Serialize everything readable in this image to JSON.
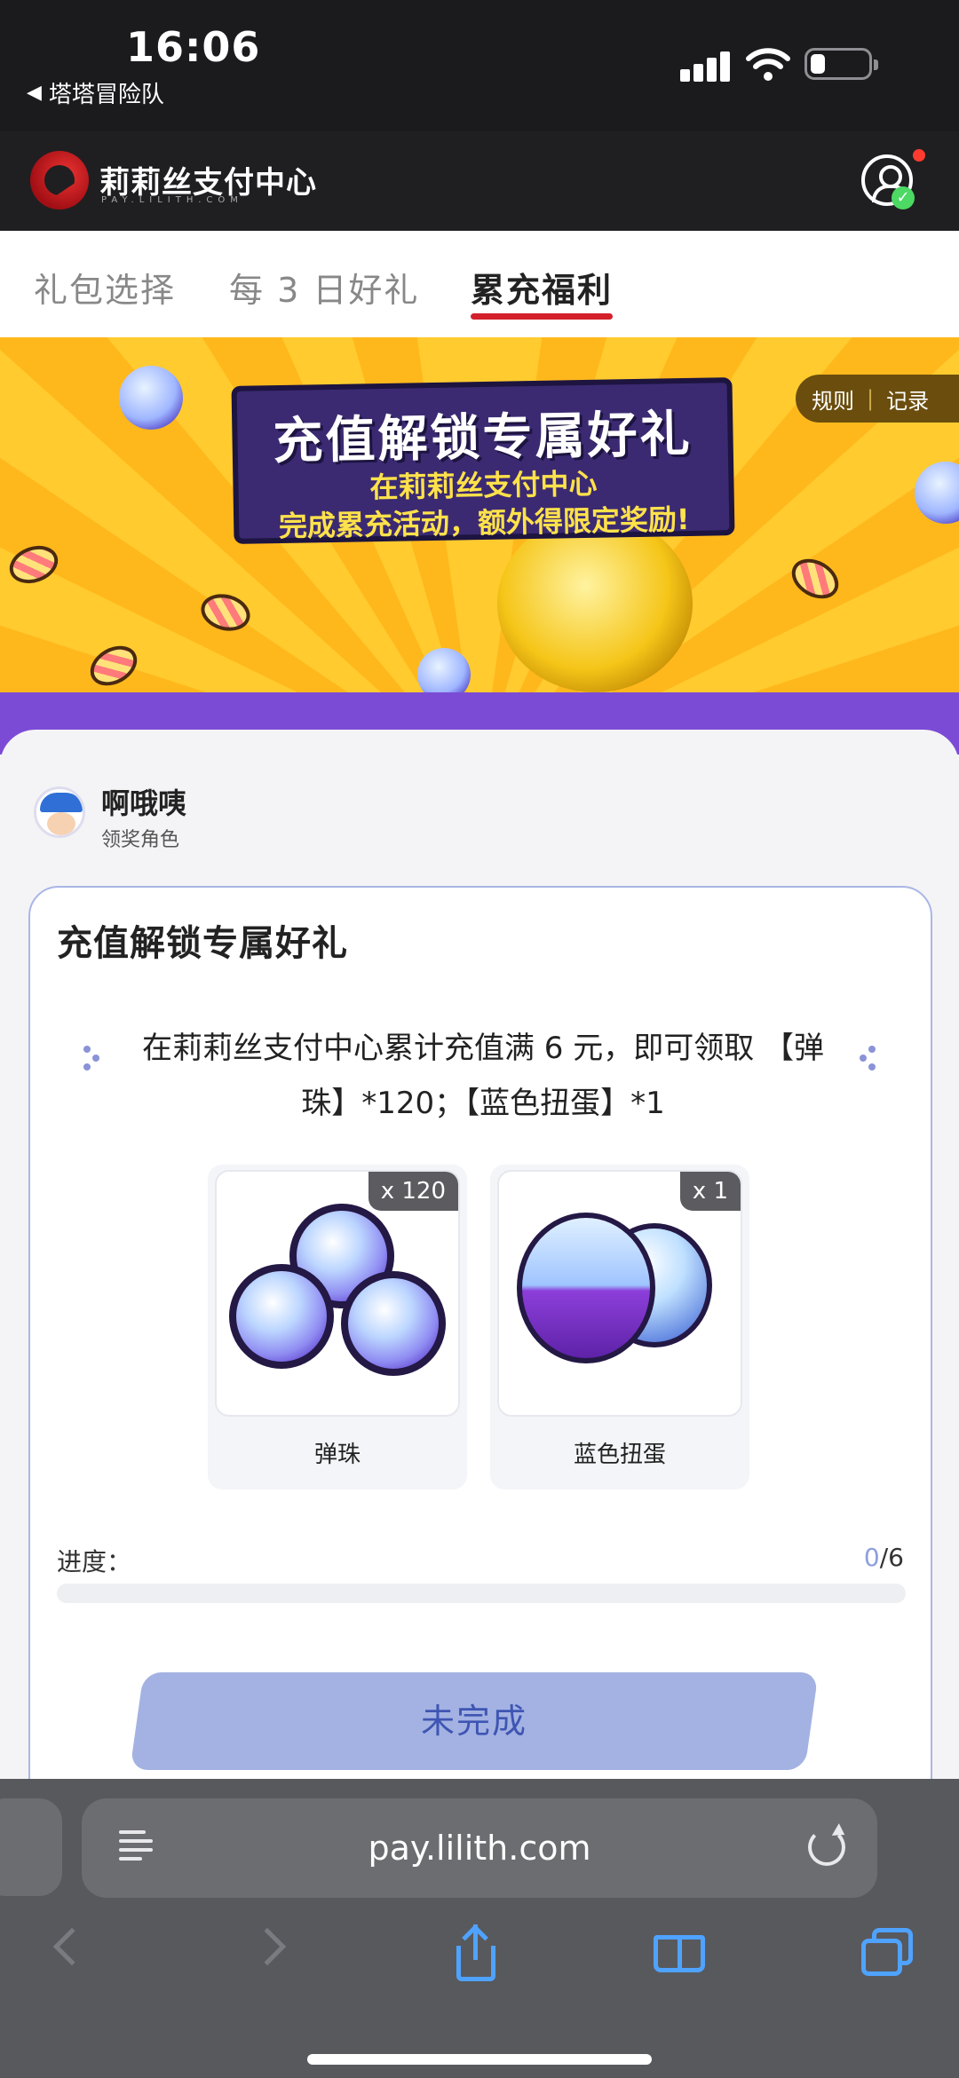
{
  "status_bar": {
    "time": "16:06",
    "back_app": "塔塔冒险队",
    "back_glyph": "◀"
  },
  "header": {
    "brand": "莉莉丝支付中心",
    "brand_sub": "PAY.LILITH.COM",
    "check_glyph": "✓"
  },
  "tabs": [
    {
      "label": "礼包选择",
      "active": false
    },
    {
      "label": "每 3 日好礼",
      "active": false
    },
    {
      "label": "累充福利",
      "active": true
    }
  ],
  "banner": {
    "title": "充值解锁专属好礼",
    "line1": "在莉莉丝支付中心",
    "line2": "完成累充活动，额外得限定奖励!",
    "rules": "规则",
    "records": "记录",
    "separator": "|"
  },
  "role": {
    "name": "啊哦咦",
    "subtitle": "领奖角色"
  },
  "task": {
    "title": "充值解锁专属好礼",
    "description": "在莉莉丝支付中心累计充值满 6 元，即可领取 【弹珠】*120；【蓝色扭蛋】*1",
    "rewards": [
      {
        "name": "弹珠",
        "quantity": "x 120"
      },
      {
        "name": "蓝色扭蛋",
        "quantity": "x 1"
      }
    ],
    "progress_label": "进度：",
    "progress_current": "0",
    "progress_total": "/6",
    "progress_fraction": 0,
    "button_label": "未完成"
  },
  "browser": {
    "url": "pay.lilith.com"
  },
  "colors": {
    "accent_red": "#d3202a",
    "progress_blue": "#8ea0dc",
    "button_bg": "#a3b2e2",
    "safari_blue": "#4fa3ff"
  }
}
